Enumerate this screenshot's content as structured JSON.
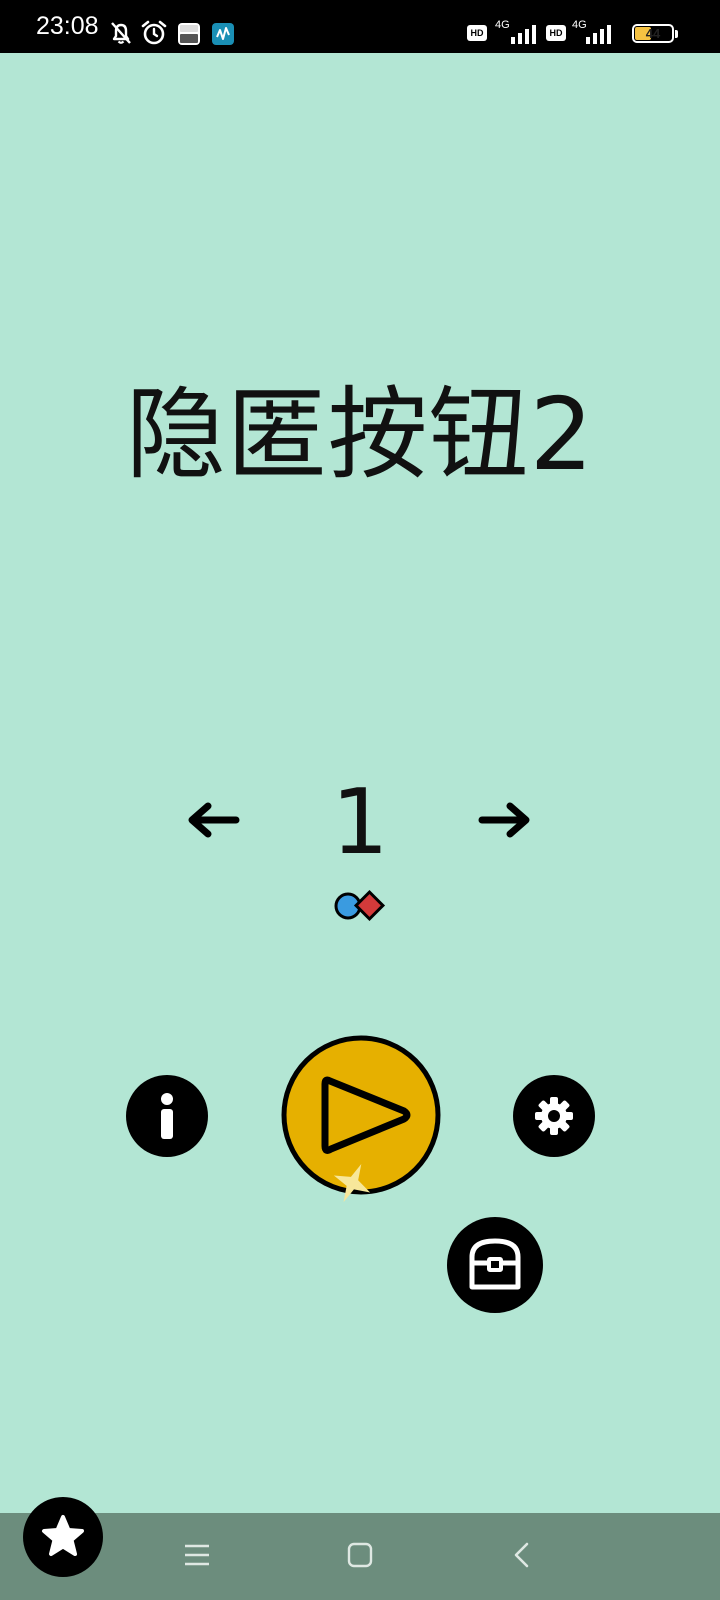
{
  "status_bar": {
    "time": "23:08",
    "hd1": "HD",
    "net1": "4G",
    "hd2": "HD",
    "net2": "4G",
    "battery": "44",
    "battery_level": 0.44,
    "icons": [
      "bell-off-icon",
      "alarm-icon",
      "app-notification-icon",
      "app-notification-icon-2",
      "signal-icon",
      "battery-icon"
    ]
  },
  "game": {
    "title": "隐匿按钮2",
    "level": "1",
    "accent_color": "#e6b000",
    "background_color": "#b3e6d4"
  },
  "buttons": {
    "prev": "arrow-left-icon",
    "next": "arrow-right-icon",
    "info": "info-icon",
    "play": "play-icon",
    "settings": "gear-icon",
    "chest": "treasure-chest-icon",
    "favorite": "star-icon"
  },
  "nav_bar": {
    "icons": [
      "menu-icon",
      "home-icon",
      "back-icon"
    ]
  }
}
